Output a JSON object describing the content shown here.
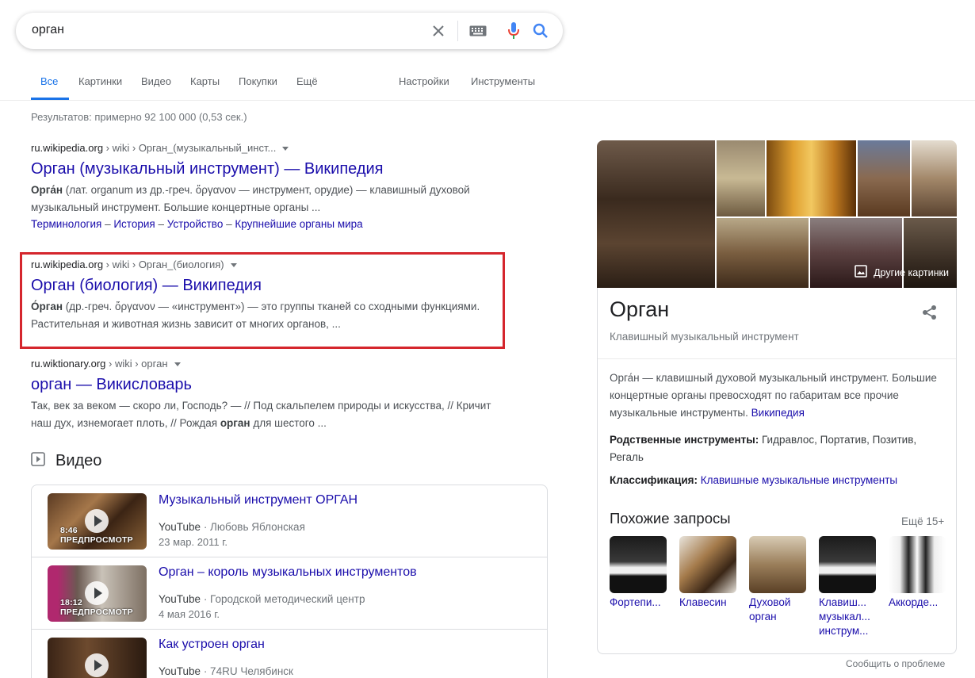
{
  "search": {
    "query": "орган",
    "icons": [
      "close-icon",
      "keyboard-icon",
      "microphone-icon",
      "search-icon"
    ],
    "colors": {
      "accent": "#1a73e8",
      "link": "#1a0dab",
      "mic_red": "#ea4335"
    }
  },
  "tabs": {
    "all": "Все",
    "images": "Картинки",
    "video": "Видео",
    "maps": "Карты",
    "shopping": "Покупки",
    "more": "Ещё",
    "settings": "Настройки",
    "tools": "Инструменты"
  },
  "stats": "Результатов: примерно 92 100 000 (0,53 сек.)",
  "results": [
    {
      "domain": "ru.wikipedia.org",
      "path": " › wiki › Орган_(музыкальный_инст...",
      "title": "Орган (музыкальный инструмент) — Википедия",
      "snippet_bold": "Орга́н",
      "snippet_rest": " (лат. organum из др.-греч. ὄργανον — инструмент, орудие) — клавишный духовой музыкальный инструмент. Большие концертные органы ...",
      "sitelinks": [
        "Терминология",
        "История",
        "Устройство",
        "Крупнейшие органы мира"
      ],
      "sitelink_sep": " – "
    },
    {
      "domain": "ru.wikipedia.org",
      "path": " › wiki › Орган_(биология)",
      "title": "Орган (биология) — Википедия",
      "snippet_bold": "О́рган",
      "snippet_rest": " (др.-греч. ὄργανον — «инструмент») — это группы тканей со сходными функциями. Растительная и животная жизнь зависит от многих органов, ..."
    },
    {
      "domain": "ru.wiktionary.org",
      "path": " › wiki › орган",
      "title": "орган — Викисловарь",
      "snippet_pre": "Так, век за веком — скоро ли, Господь? — // Под скальпелем природы и искусства, // Кричит наш дух, изнемогает плоть, // Рождая ",
      "snippet_bold": "орган",
      "snippet_post": " для шестого ..."
    }
  ],
  "videos": {
    "heading": "Видео",
    "items": [
      {
        "title": "Музыкальный инструмент ОРГАН",
        "source": "YouTube",
        "author": " · Любовь Яблонская",
        "date": "23 мар. 2011 г.",
        "duration": "8:46",
        "preview": "ПРЕДПРОСМОТР"
      },
      {
        "title": "Орган – король музыкальных инструментов",
        "source": "YouTube",
        "author": " · Городской методический центр",
        "date": "4 мая 2016 г.",
        "duration": "18:12",
        "preview": "ПРЕДПРОСМОТР"
      },
      {
        "title": "Как устроен орган",
        "source": "YouTube",
        "author": " · 74RU Челябинск",
        "date": "",
        "duration": "",
        "preview": ""
      }
    ]
  },
  "knowledge_panel": {
    "more_images": "Другие картинки",
    "title": "Орган",
    "subtitle": "Клавишный музыкальный инструмент",
    "description": "Орга́н — клавишный духовой музыкальный инструмент. Большие концертные органы превосходят по габаритам все прочие музыкальные инструменты.",
    "source_link": "Википедия",
    "related_label": "Родственные инструменты:",
    "related_value": " Гидравлос, Портатив, Позитив, Регаль",
    "class_label": "Классификация:",
    "class_value": "Клавишные музыкальные инструменты",
    "similar_heading": "Похожие запросы",
    "similar_more": "Ещё 15+",
    "similar": [
      {
        "label": "Фортепи..."
      },
      {
        "label": "Клавесин"
      },
      {
        "label": "Духовой орган"
      },
      {
        "label": "Клавиш... музыкал... инструм..."
      },
      {
        "label": "Аккорде..."
      }
    ]
  },
  "report": "Сообщить о проблеме"
}
